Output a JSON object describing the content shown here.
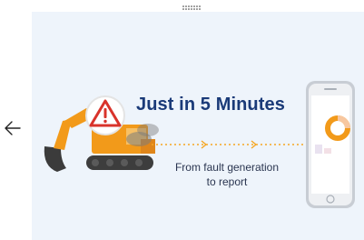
{
  "banner": {
    "headline": "Just in 5 Minutes",
    "subtitle_line1": "From fault generation",
    "subtitle_line2": "to report"
  },
  "icons": {
    "back": "arrow-left-icon",
    "warning": "warning-triangle-icon",
    "excavator": "excavator-icon",
    "phone": "smartphone-icon",
    "dots": "dotted-pattern-icon"
  },
  "colors": {
    "banner_background": "#eef4fb",
    "headline": "#1a3a78",
    "excavator_body": "#f29a1a",
    "warning_red": "#d9332b",
    "connector": "#f5a623"
  }
}
